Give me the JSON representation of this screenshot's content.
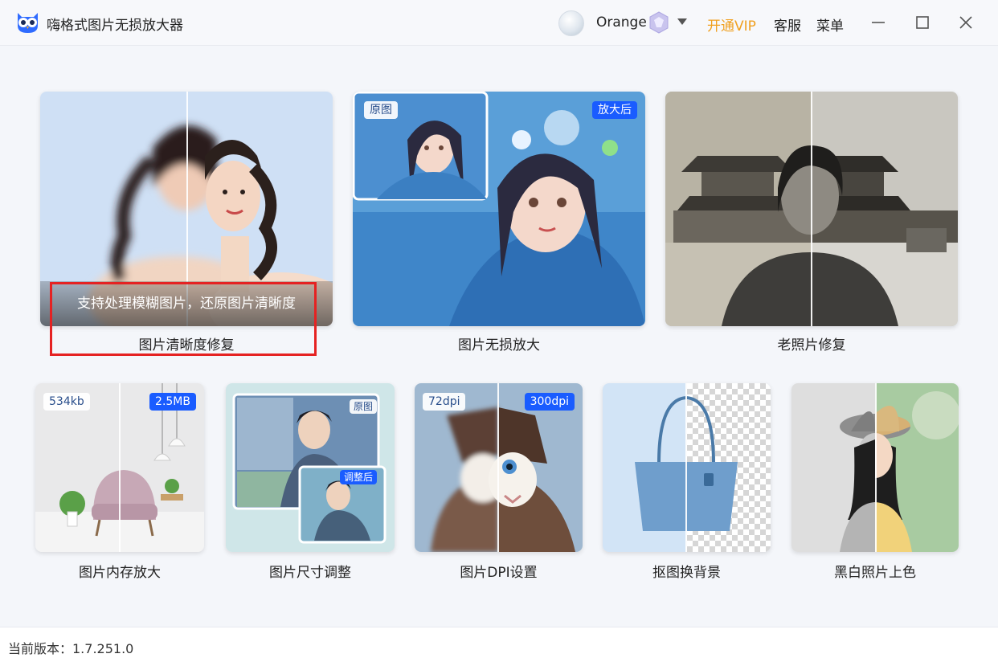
{
  "app": {
    "title": "嗨格式图片无损放大器",
    "username": "Orange",
    "vip_link": "开通VIP",
    "service_link": "客服",
    "menu_link": "菜单"
  },
  "colors": {
    "accent_blue": "#1a5cff",
    "vip_orange": "#f0a020",
    "highlight_red": "#e52222"
  },
  "features_top": [
    {
      "label": "图片清晰度修复",
      "hover_text": "支持处理模糊图片，还原图片清晰度"
    },
    {
      "label": "图片无损放大",
      "tag_left": "原图",
      "tag_right": "放大后"
    },
    {
      "label": "老照片修复"
    }
  ],
  "features_bottom": [
    {
      "label": "图片内存放大",
      "tag_left": "534kb",
      "tag_right": "2.5MB"
    },
    {
      "label": "图片尺寸调整",
      "tag_left": "原图",
      "tag_right": "调整后"
    },
    {
      "label": "图片DPI设置",
      "tag_left": "72dpi",
      "tag_right": "300dpi"
    },
    {
      "label": "抠图换背景"
    },
    {
      "label": "黑白照片上色"
    }
  ],
  "icons": {
    "logo": "owl-logo-icon",
    "vip": "vip-diamond-icon",
    "dropdown": "chevron-down-icon",
    "minimize": "minimize-icon",
    "maximize": "maximize-icon",
    "close": "close-icon"
  },
  "footer": {
    "version": "当前版本：1.7.251.0"
  }
}
